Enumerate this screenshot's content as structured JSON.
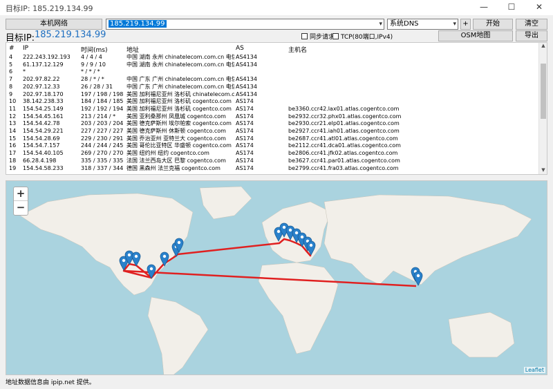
{
  "window": {
    "title": "目标IP: 185.219.134.99",
    "minimize": "—",
    "maximize": "☐",
    "close": "✕"
  },
  "toolbar": {
    "local_network_button": "本机网络",
    "ip_input_value": "185.219.134.99",
    "dns_select_value": "系统DNS",
    "add_button": "+",
    "start_button": "开始",
    "clear_button": "清空",
    "osm_button": "OSM地图",
    "export_button": "导出"
  },
  "target": {
    "label": "目标IP:",
    "ip": "185.219.134.99"
  },
  "options": {
    "sync_request": "同步请求",
    "tcp_mode": "TCP(80端口,IPv4)"
  },
  "table": {
    "headers": [
      "#",
      "IP",
      "时间(ms)",
      "地址",
      "AS",
      "主机名"
    ],
    "rows": [
      [
        "4",
        "222.243.192.193",
        "4 / 4 / 4",
        "中国 湖南 永州 chinatelecom.com.cn 电信",
        "AS4134",
        ""
      ],
      [
        "5",
        "61.137.12.129",
        "9 / 9 / 10",
        "中国 湖南 永州 chinatelecom.com.cn 电信",
        "AS4134",
        ""
      ],
      [
        "6",
        "*",
        "* / * / *",
        "",
        "",
        ""
      ],
      [
        "7",
        "202.97.82.22",
        "28 / * / *",
        "中国 广东 广州 chinatelecom.com.cn 电信",
        "AS4134",
        ""
      ],
      [
        "8",
        "202.97.12.33",
        "26 / 28 / 31",
        "中国 广东 广州 chinatelecom.com.cn 电信",
        "AS4134",
        ""
      ],
      [
        "9",
        "202.97.18.170",
        "197 / 198 / 198",
        "美国 加利福尼亚州 洛杉矶 chinatelecom.c...",
        "AS4134",
        ""
      ],
      [
        "10",
        "38.142.238.33",
        "184 / 184 / 185",
        "美国 加利福尼亚州 洛杉矶 cogentco.com",
        "AS174",
        ""
      ],
      [
        "11",
        "154.54.25.149",
        "192 / 192 / 194",
        "美国 加利福尼亚州 洛杉矶 cogentco.com",
        "AS174",
        "be3360.ccr42.lax01.atlas.cogentco.com"
      ],
      [
        "12",
        "154.54.45.161",
        "213 / 214 / *",
        "美国 亚利桑那州 凤凰城 cogentco.com",
        "AS174",
        "be2932.ccr32.phx01.atlas.cogentco.com"
      ],
      [
        "13",
        "154.54.42.78",
        "203 / 203 / 204",
        "美国 德克萨斯州 埃尔帕索 cogentco.com",
        "AS174",
        "be2930.ccr21.elp01.atlas.cogentco.com"
      ],
      [
        "14",
        "154.54.29.221",
        "227 / 227 / 227",
        "美国 德克萨斯州 休斯顿 cogentco.com",
        "AS174",
        "be2927.ccr41.iah01.atlas.cogentco.com"
      ],
      [
        "15",
        "154.54.28.69",
        "229 / 230 / 291",
        "美国 乔治亚州 亚特兰大 cogentco.com",
        "AS174",
        "be2687.ccr41.atl01.atlas.cogentco.com"
      ],
      [
        "16",
        "154.54.7.157",
        "244 / 244 / 245",
        "美国 哥伦比亚特区 华盛顿 cogentco.com",
        "AS174",
        "be2112.ccr41.dca01.atlas.cogentco.com"
      ],
      [
        "17",
        "154.54.40.105",
        "269 / 270 / 270",
        "美国 纽约州 纽约 cogentco.com",
        "AS174",
        "be2806.ccr41.jfk02.atlas.cogentco.com"
      ],
      [
        "18",
        "66.28.4.198",
        "335 / 335 / 335",
        "法国 法兰西岛大区 巴黎 cogentco.com",
        "AS174",
        "be3627.ccr41.par01.atlas.cogentco.com"
      ],
      [
        "19",
        "154.54.58.233",
        "318 / 337 / 344",
        "德国 黑森州 法兰克福 cogentco.com",
        "AS174",
        "be2799.ccr41.fra03.atlas.cogentco.com"
      ]
    ]
  },
  "map": {
    "zoom_in": "+",
    "zoom_out": "−",
    "attribution": "Leaflet"
  },
  "status": {
    "text": "地址数据信息由 ipip.net 提供。"
  },
  "colors": {
    "accent": "#1e6fc0",
    "route": "#e02020",
    "marker": "#2a81cb",
    "land": "#f2efe9",
    "water": "#aad3df"
  }
}
